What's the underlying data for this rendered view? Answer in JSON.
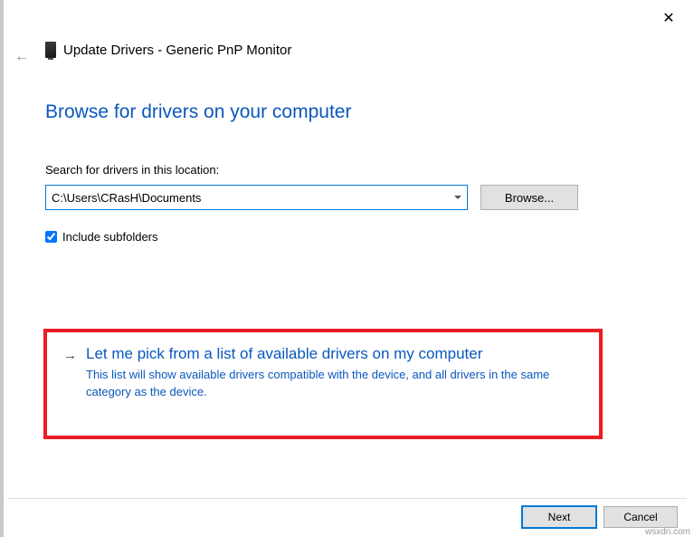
{
  "window": {
    "title": "Update Drivers - Generic PnP Monitor"
  },
  "heading": "Browse for drivers on your computer",
  "search": {
    "label": "Search for drivers in this location:",
    "path_value": "C:\\Users\\CRasH\\Documents",
    "browse_label": "Browse..."
  },
  "include_subfolders": {
    "label": "Include subfolders",
    "checked": true
  },
  "pick": {
    "title": "Let me pick from a list of available drivers on my computer",
    "description": "This list will show available drivers compatible with the device, and all drivers in the same category as the device."
  },
  "buttons": {
    "next": "Next",
    "cancel": "Cancel"
  },
  "watermark": "wsxdn.com",
  "icons": {
    "close": "✕",
    "back": "←",
    "arrow": "→"
  }
}
